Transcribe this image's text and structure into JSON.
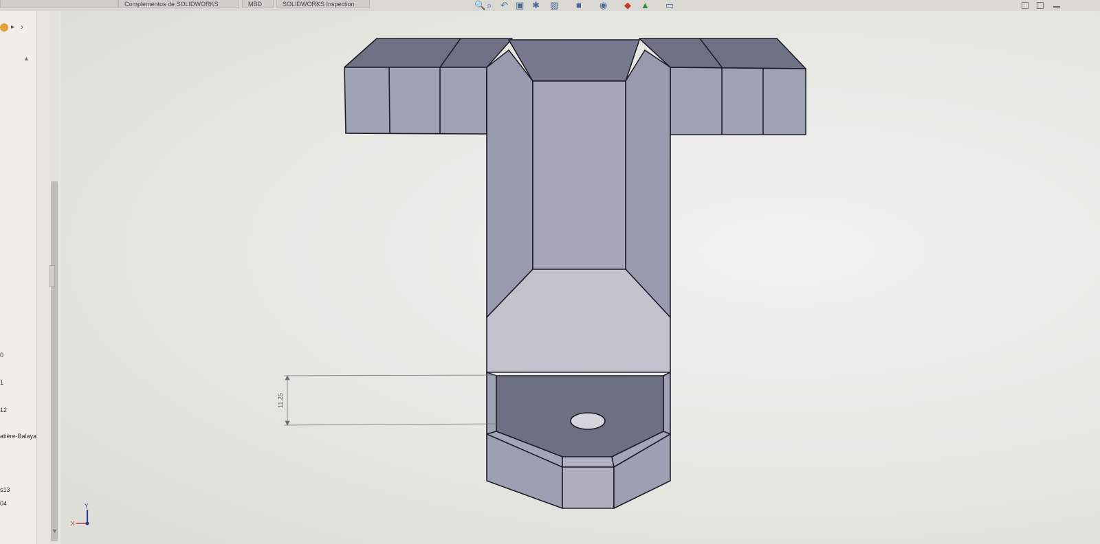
{
  "toolbar": {
    "tabs": [
      "Complementos de SOLIDWORKS",
      "MBD",
      "SOLIDWORKS Inspection"
    ],
    "view_icons": [
      "zoom-to-fit-icon",
      "zoom-area-icon",
      "previous-view-icon",
      "section-view-icon",
      "dynamic-annotation-icon",
      "view-orientation-icon",
      "display-style-icon",
      "hide-show-icon",
      "edit-appearance-icon",
      "apply-scene-icon",
      "view-settings-icon"
    ]
  },
  "left_panel": {
    "items": [
      "0",
      "1",
      "12",
      "atière-Balaya",
      "s13",
      "04"
    ]
  },
  "dimension": {
    "value": "11.25"
  },
  "colors": {
    "viewport_bg": "#e8e8e3",
    "model_face_light": "#a9abbc",
    "model_face_mid": "#9899ad",
    "model_face_dark": "#6d6f82",
    "model_edge": "#1e1e28"
  }
}
